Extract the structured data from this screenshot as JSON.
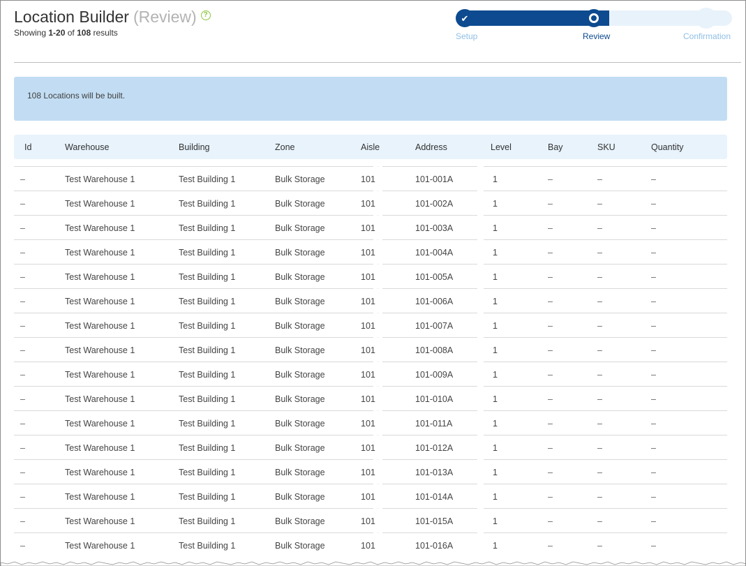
{
  "header": {
    "title": "Location Builder",
    "subtitle": "(Review)",
    "help_icon": "question-circle-icon",
    "showing_prefix": "Showing ",
    "showing_range": "1-20",
    "showing_of": " of ",
    "showing_total": "108",
    "showing_suffix": " results"
  },
  "stepper": {
    "steps": [
      {
        "label": "Setup",
        "state": "complete"
      },
      {
        "label": "Review",
        "state": "current"
      },
      {
        "label": "Confirmation",
        "state": "pending"
      }
    ]
  },
  "alert": {
    "message": "108 Locations will be built."
  },
  "table": {
    "columns": [
      "Id",
      "Warehouse",
      "Building",
      "Zone",
      "Aisle",
      "Address",
      "Level",
      "Bay",
      "SKU",
      "Quantity"
    ],
    "rows": [
      [
        "–",
        "Test Warehouse 1",
        "Test Building 1",
        "Bulk Storage",
        "101",
        "101-001A",
        "1",
        "–",
        "–",
        "–"
      ],
      [
        "–",
        "Test Warehouse 1",
        "Test Building 1",
        "Bulk Storage",
        "101",
        "101-002A",
        "1",
        "–",
        "–",
        "–"
      ],
      [
        "–",
        "Test Warehouse 1",
        "Test Building 1",
        "Bulk Storage",
        "101",
        "101-003A",
        "1",
        "–",
        "–",
        "–"
      ],
      [
        "–",
        "Test Warehouse 1",
        "Test Building 1",
        "Bulk Storage",
        "101",
        "101-004A",
        "1",
        "–",
        "–",
        "–"
      ],
      [
        "–",
        "Test Warehouse 1",
        "Test Building 1",
        "Bulk Storage",
        "101",
        "101-005A",
        "1",
        "–",
        "–",
        "–"
      ],
      [
        "–",
        "Test Warehouse 1",
        "Test Building 1",
        "Bulk Storage",
        "101",
        "101-006A",
        "1",
        "–",
        "–",
        "–"
      ],
      [
        "–",
        "Test Warehouse 1",
        "Test Building 1",
        "Bulk Storage",
        "101",
        "101-007A",
        "1",
        "–",
        "–",
        "–"
      ],
      [
        "–",
        "Test Warehouse 1",
        "Test Building 1",
        "Bulk Storage",
        "101",
        "101-008A",
        "1",
        "–",
        "–",
        "–"
      ],
      [
        "–",
        "Test Warehouse 1",
        "Test Building 1",
        "Bulk Storage",
        "101",
        "101-009A",
        "1",
        "–",
        "–",
        "–"
      ],
      [
        "–",
        "Test Warehouse 1",
        "Test Building 1",
        "Bulk Storage",
        "101",
        "101-010A",
        "1",
        "–",
        "–",
        "–"
      ],
      [
        "–",
        "Test Warehouse 1",
        "Test Building 1",
        "Bulk Storage",
        "101",
        "101-011A",
        "1",
        "–",
        "–",
        "–"
      ],
      [
        "–",
        "Test Warehouse 1",
        "Test Building 1",
        "Bulk Storage",
        "101",
        "101-012A",
        "1",
        "–",
        "–",
        "–"
      ],
      [
        "–",
        "Test Warehouse 1",
        "Test Building 1",
        "Bulk Storage",
        "101",
        "101-013A",
        "1",
        "–",
        "–",
        "–"
      ],
      [
        "–",
        "Test Warehouse 1",
        "Test Building 1",
        "Bulk Storage",
        "101",
        "101-014A",
        "1",
        "–",
        "–",
        "–"
      ],
      [
        "–",
        "Test Warehouse 1",
        "Test Building 1",
        "Bulk Storage",
        "101",
        "101-015A",
        "1",
        "–",
        "–",
        "–"
      ],
      [
        "–",
        "Test Warehouse 1",
        "Test Building 1",
        "Bulk Storage",
        "101",
        "101-016A",
        "1",
        "–",
        "–",
        "–"
      ]
    ]
  },
  "colors": {
    "primary": "#0d4a8f",
    "step_pending": "#8fbfe6",
    "track_light": "#e8f2fb",
    "alert_bg": "#c2ddf3",
    "header_bg": "#e8f3fc",
    "help_green": "#8dc63f"
  }
}
